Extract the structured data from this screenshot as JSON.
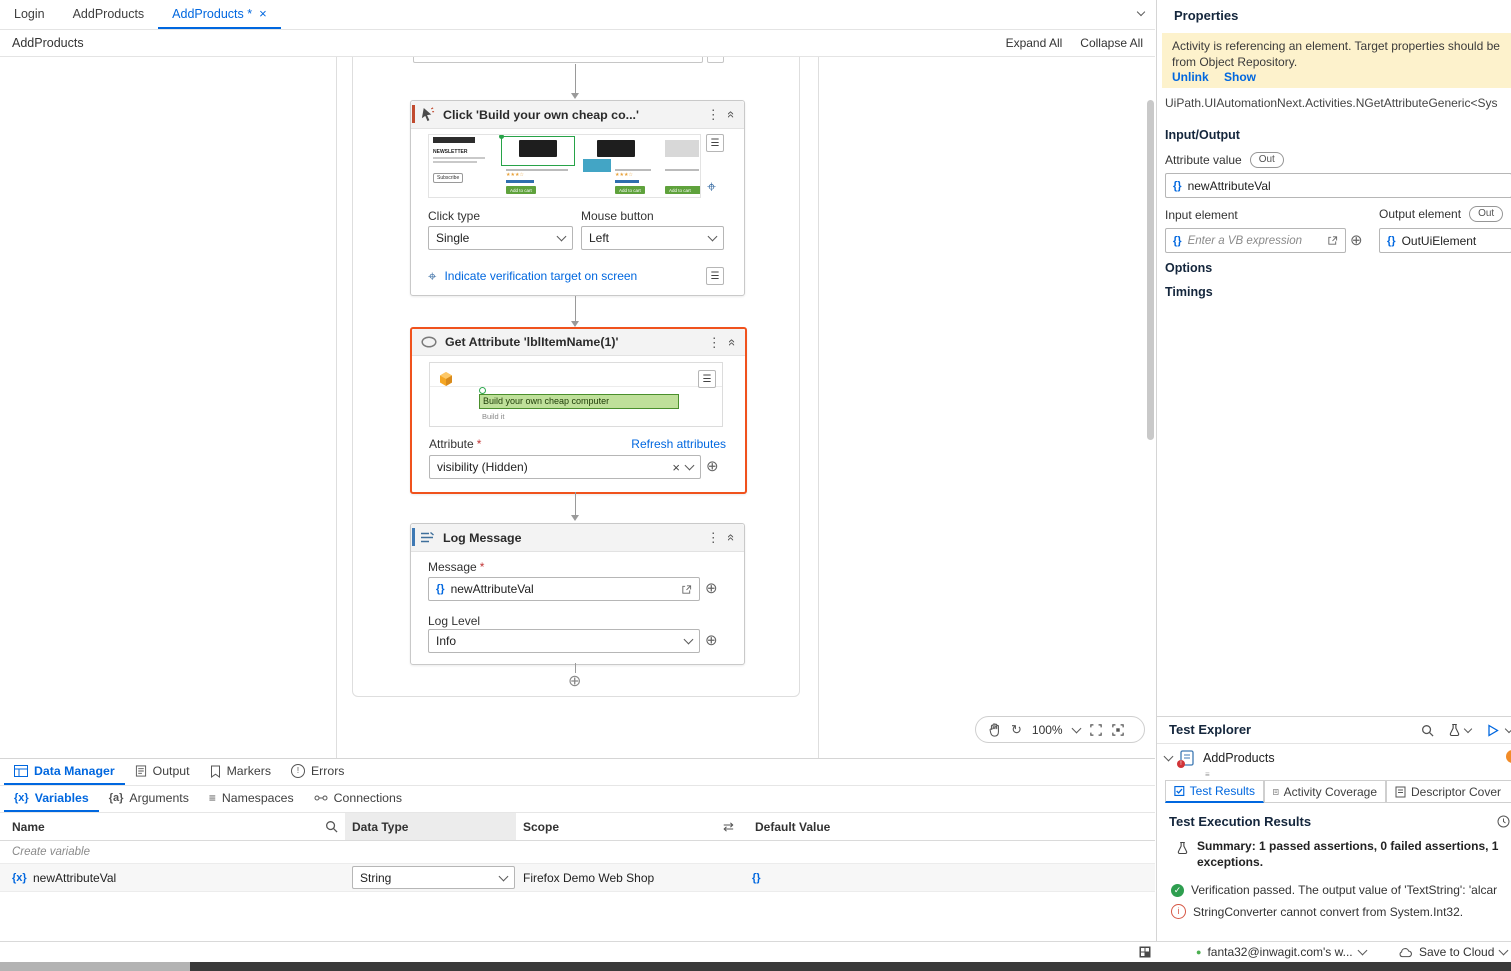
{
  "icons": {
    "kebab": "⋮",
    "burger": "☰",
    "target": "⌖",
    "plus_circle": "⊕",
    "clear": "×",
    "collapse": "«",
    "swap": "⇄",
    "var": "{x}",
    "arg": "{a}",
    "braces": "{}",
    "namespaces": "≡",
    "reset_zoom": "↻",
    "check": "✓",
    "dot": "●",
    "stars": "★★★☆",
    "error_mark": "!",
    "info_mark": "i"
  },
  "tabs": {
    "items": [
      {
        "label": "Login"
      },
      {
        "label": "AddProducts"
      },
      {
        "label": "AddProducts *"
      }
    ],
    "close": "×"
  },
  "breadcrumb": {
    "title": "AddProducts",
    "expand_all": "Expand All",
    "collapse_all": "Collapse All"
  },
  "canvas": {
    "click": {
      "title": "Click 'Build your own cheap co...'",
      "click_type_label": "Click type",
      "click_type": "Single",
      "mouse_button_label": "Mouse button",
      "mouse_button": "Left",
      "verify_link": "Indicate verification target on screen",
      "thumb": {
        "newsletter": "NEWSLETTER",
        "subscribe": "Subscribe",
        "add_to_cart": "Add to cart"
      }
    },
    "get_attribute": {
      "title": "Get Attribute 'lblItemName(1)'",
      "highlight": "Build your own cheap computer",
      "highlight_sub": "Build it",
      "attribute_label": "Attribute",
      "required": "*",
      "refresh_link": "Refresh attributes",
      "value": "visibility (Hidden)"
    },
    "log": {
      "title": "Log Message",
      "message_label": "Message",
      "required": "*",
      "message_value": "newAttributeVal",
      "level_label": "Log Level",
      "level": "Info"
    },
    "zoom": "100%"
  },
  "dock": {
    "tabs": [
      {
        "label": "Data Manager"
      },
      {
        "label": "Output"
      },
      {
        "label": "Markers"
      },
      {
        "label": "Errors"
      }
    ],
    "subtabs": [
      {
        "label": "Variables"
      },
      {
        "label": "Arguments"
      },
      {
        "label": "Namespaces"
      },
      {
        "label": "Connections"
      }
    ],
    "grid": {
      "name_header": "Name",
      "type_header": "Data Type",
      "scope_header": "Scope",
      "default_header": "Default Value",
      "create_label": "Create variable",
      "row": {
        "name": "newAttributeVal",
        "type": "String",
        "scope": "Firefox Demo Web Shop",
        "default": "{}"
      }
    }
  },
  "properties": {
    "title": "Properties",
    "notice": "Activity is referencing an element. Target properties should be from Object Repository.",
    "unlink": "Unlink",
    "show": "Show",
    "activity_type": "UiPath.UIAutomationNext.Activities.NGetAttributeGeneric<Sys",
    "io_section": "Input/Output",
    "attribute_value_label": "Attribute value",
    "out": "Out",
    "attribute_value": "newAttributeVal",
    "input_element_label": "Input element",
    "input_placeholder": "Enter a VB expression",
    "output_element_label": "Output element",
    "output_value": "OutUiElement",
    "options_section": "Options",
    "timings_section": "Timings"
  },
  "test_explorer": {
    "title": "Test Explorer",
    "tree_item": "AddProducts",
    "tabs": [
      {
        "label": "Test Results"
      },
      {
        "label": "Activity Coverage"
      },
      {
        "label": "Descriptor Cover"
      }
    ],
    "results_title": "Test Execution Results",
    "summary": "Summary: 1 passed assertions, 0 failed assertions, 1 exceptions.",
    "passed": "Verification passed. The output value of 'TextString': 'alcar",
    "error": "StringConverter cannot convert from System.Int32."
  },
  "statusbar": {
    "account": "fanta32@inwagit.com's w...",
    "save": "Save to Cloud"
  }
}
